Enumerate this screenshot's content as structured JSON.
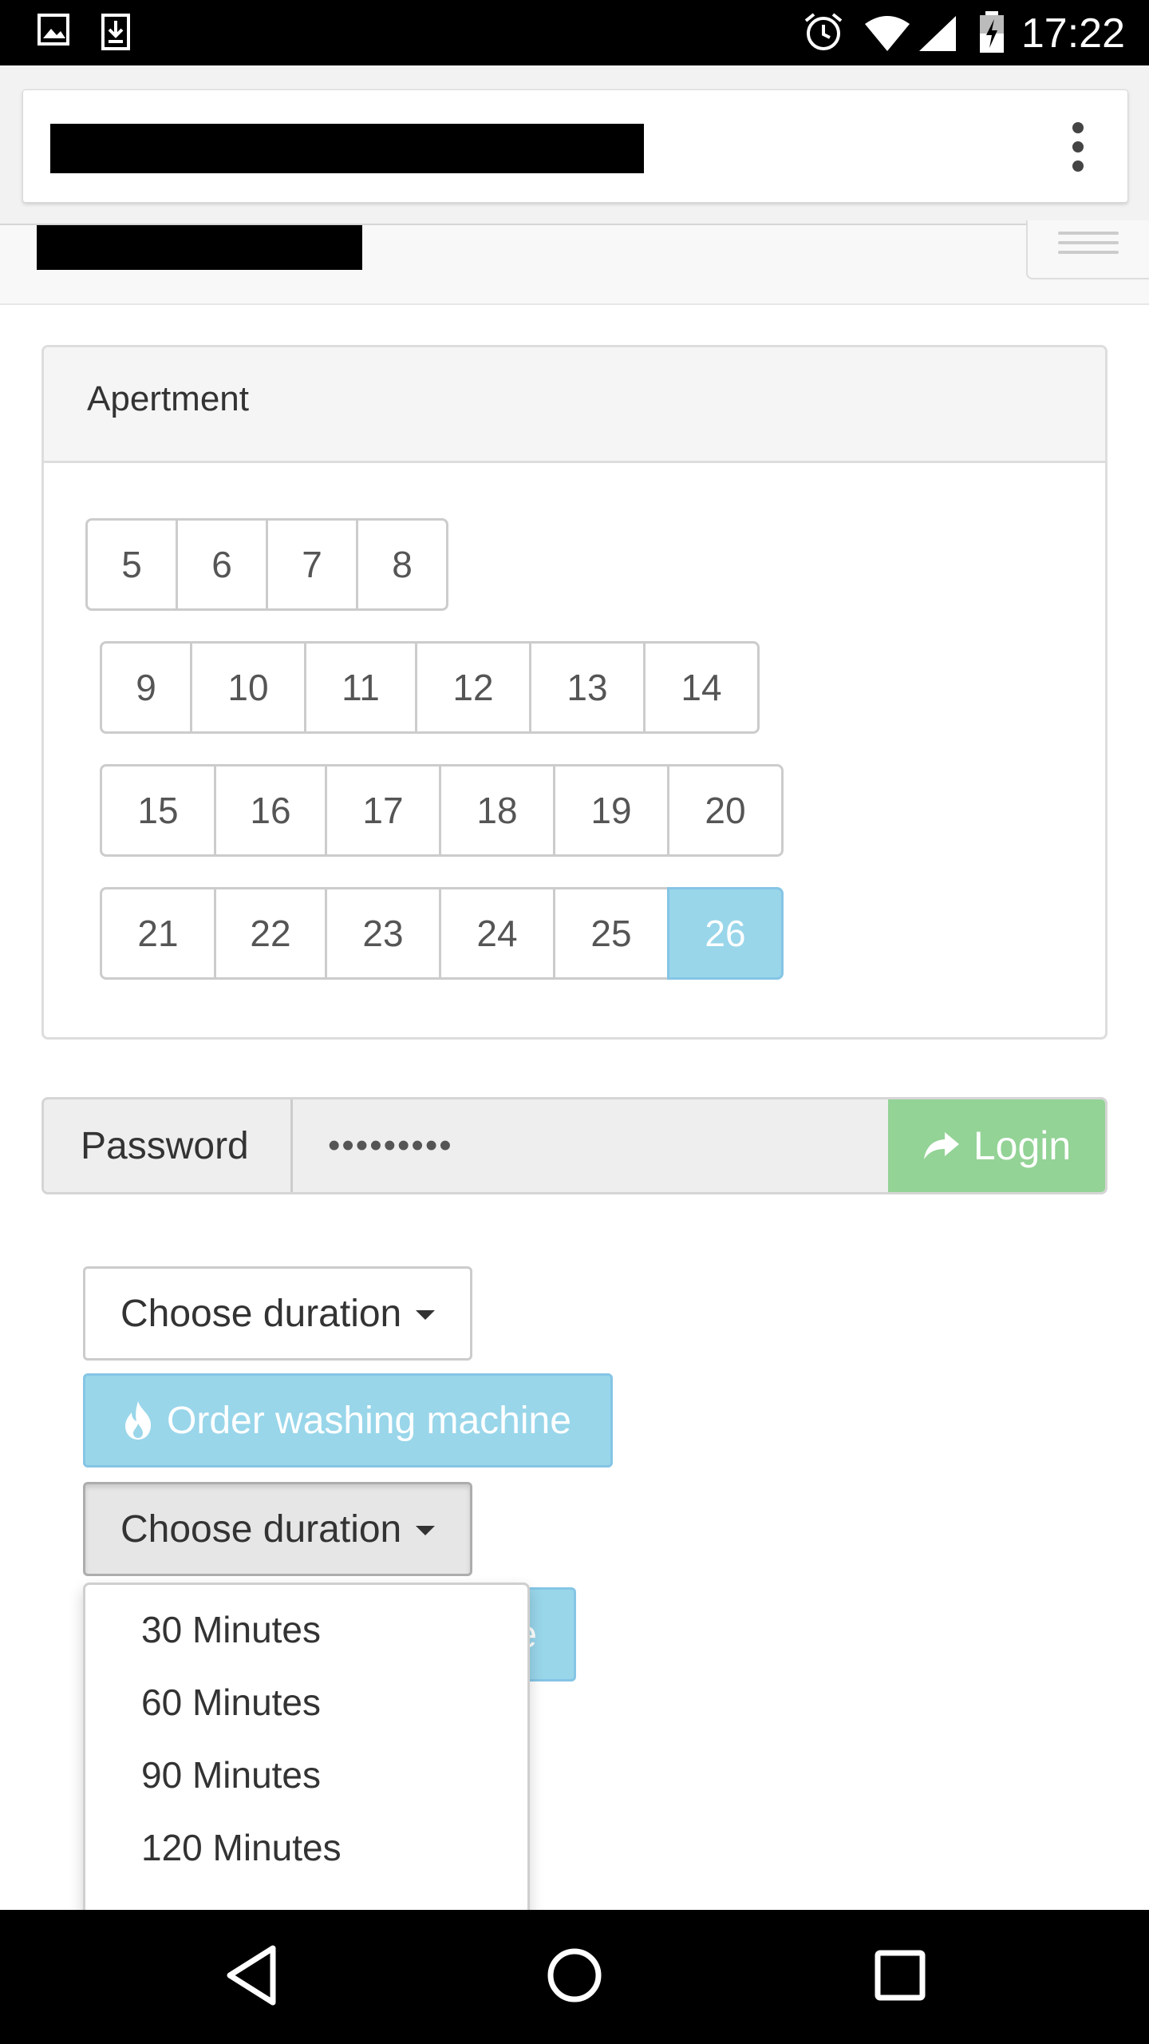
{
  "status_bar": {
    "time": "17:22",
    "left_icons": [
      "image-icon",
      "download-icon"
    ],
    "right_icons": [
      "alarm-icon",
      "wifi-icon",
      "signal-icon",
      "battery-charging-icon"
    ]
  },
  "browser": {
    "menu_icon": "overflow-menu-icon"
  },
  "navbar": {
    "menu_icon": "hamburger-icon"
  },
  "panel": {
    "title": "Apertment",
    "rows": [
      [
        "5",
        "6",
        "7",
        "8"
      ],
      [
        "9",
        "10",
        "11",
        "12",
        "13",
        "14"
      ],
      [
        "15",
        "16",
        "17",
        "18",
        "19",
        "20"
      ],
      [
        "21",
        "22",
        "23",
        "24",
        "25",
        "26"
      ]
    ],
    "active": "26"
  },
  "login": {
    "label": "Password",
    "value": "•••••••••",
    "button": "Login",
    "button_icon": "share-arrow-icon"
  },
  "order1": {
    "duration_label": "Choose duration",
    "order_label": "Order washing machine",
    "order_icon": "fire-icon"
  },
  "order2": {
    "duration_label": "Choose duration",
    "order_label_visible": "e",
    "options": [
      "30 Minutes",
      "60 Minutes",
      "90 Minutes",
      "120 Minutes"
    ]
  },
  "colors": {
    "info": "#99d6ea",
    "success": "#93d396",
    "border": "#cccccc"
  }
}
